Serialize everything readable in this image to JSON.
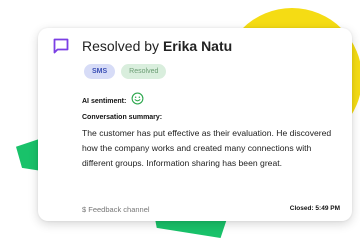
{
  "card": {
    "title_prefix": "Resolved by",
    "title_name": "Erika Natu",
    "channel_badge": "SMS",
    "status_badge": "Resolved",
    "sentiment_label": "AI sentiment:",
    "sentiment_icon": "smiley-face-icon",
    "summary_label": "Conversation summary:",
    "summary_text": "The customer has put effective as their evaluation. He discovered how the company works and created many connections with different groups. Information sharing has been great.",
    "feedback_channel": "$ Feedback channel",
    "closed_time": "Closed: 5:49 PM"
  },
  "icons": {
    "header": "chat-bubble-icon"
  },
  "colors": {
    "accent_purple": "#7b3fe4",
    "deco_yellow": "#f5dc14",
    "deco_green": "#19c26a",
    "sentiment_green": "#2fa84f",
    "badge_sms_bg": "#d7dcf7",
    "badge_status_bg": "#d9eedd"
  }
}
